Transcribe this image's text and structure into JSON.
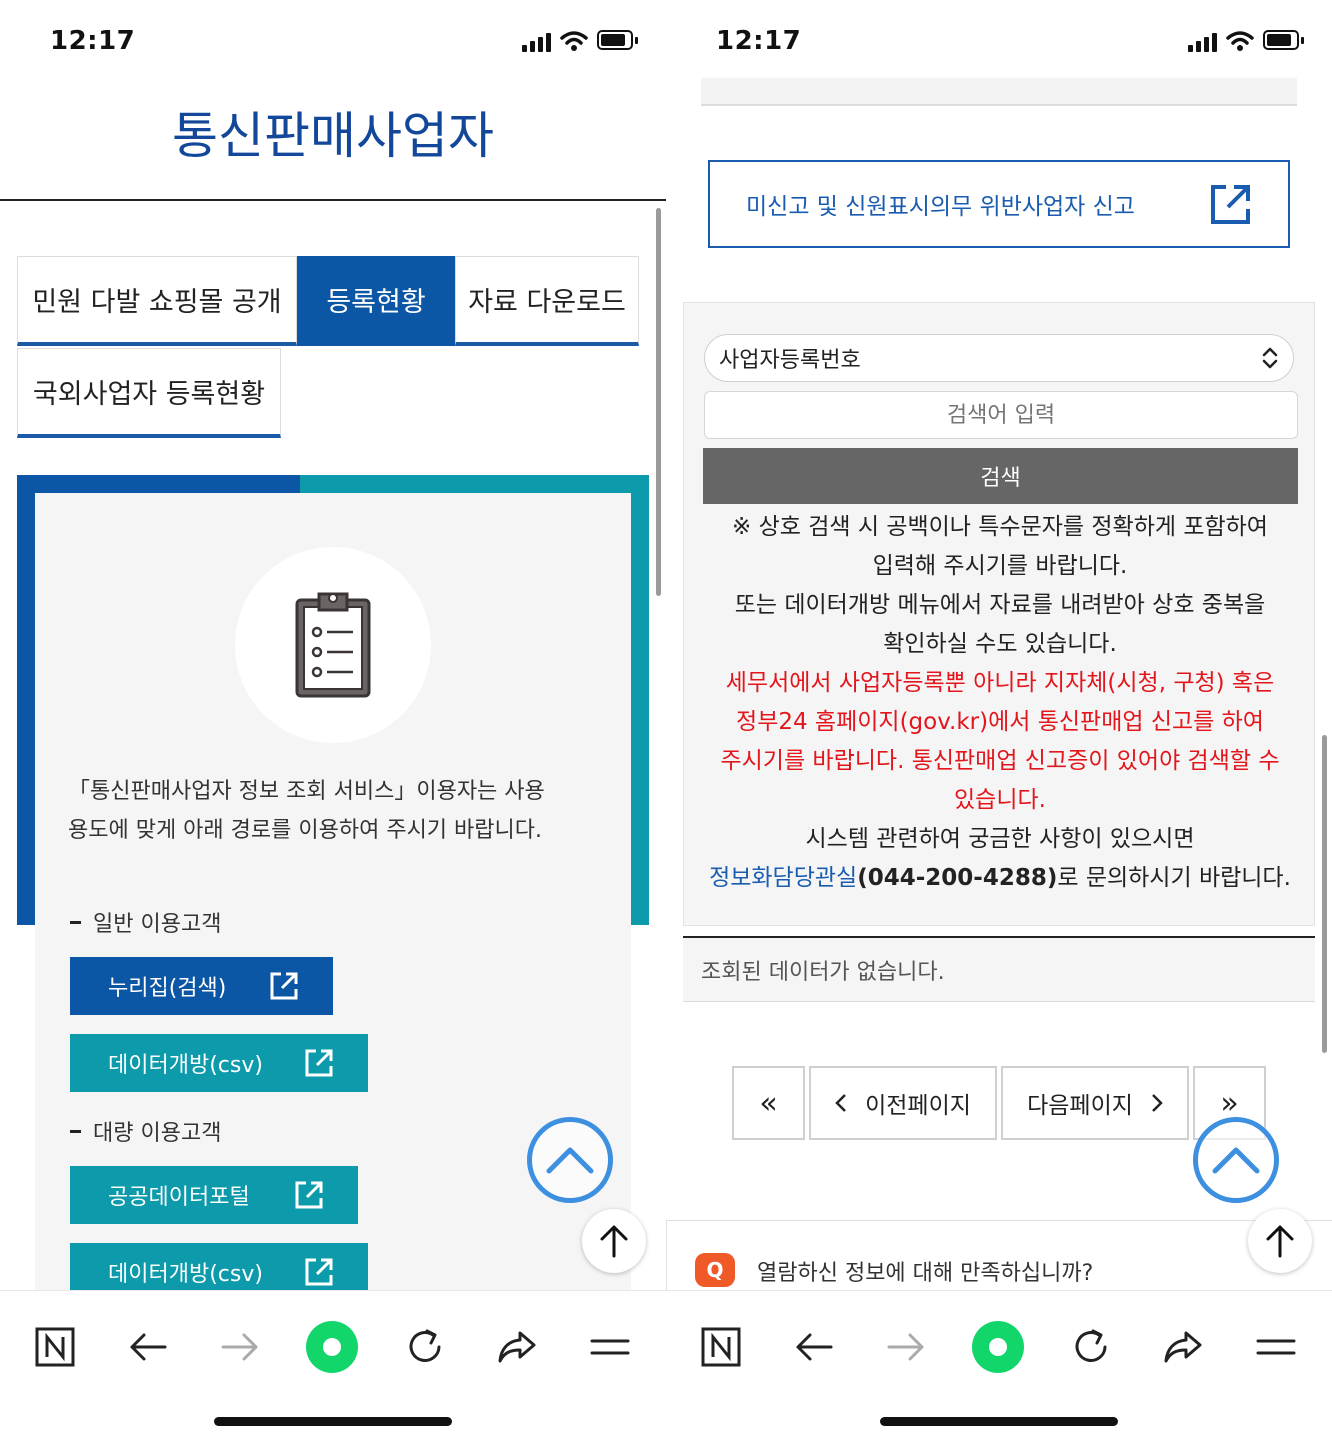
{
  "status_bar": {
    "time": "12:17"
  },
  "left": {
    "page_title": "통신판매사업자",
    "tabs": [
      {
        "label": "민원 다발 쇼핑몰 공개",
        "active": false
      },
      {
        "label": "등록현황",
        "active": true
      },
      {
        "label": "자료 다운로드",
        "active": false
      },
      {
        "label": "국외사업자 등록현황",
        "active": false
      }
    ],
    "card": {
      "icon": "clipboard-list-icon",
      "intro_line1": "「통신판매사업자 정보 조회 서비스」이용자는 사용",
      "intro_line2": "용도에 맞게 아래 경로를 이용하여 주시기 바랍니다.",
      "section_general": "일반 이용고객",
      "section_bulk": "대량 이용고객",
      "btn_nurijip": "누리집(검색)",
      "btn_open_data_1": "데이터개방(csv)",
      "btn_portal": "공공데이터포털",
      "btn_open_data_2": "데이터개방(csv)"
    }
  },
  "right": {
    "report_button": "미신고 및 신원표시의무 위반사업자 신고",
    "search": {
      "select_value": "사업자등록번호",
      "input_placeholder": "검색어 입력",
      "button": "검색"
    },
    "notice": {
      "line1": "※ 상호 검색 시 공백이나 특수문자를 정확하게 포함하여",
      "line2": "입력해 주시기를 바랍니다.",
      "line3": "또는 데이터개방 메뉴에서 자료를 내려받아 상호 중복을",
      "line4": "확인하실 수도 있습니다.",
      "red1": "세무서에서 사업자등록뿐 아니라 지자체(시청, 구청) 혹은",
      "red2": "정부24 홈페이지(gov.kr)에서 통신판매업 신고를 하여",
      "red3": "주시기를 바랍니다. 통신판매업 신고증이 있어야 검색할 수",
      "red4": "있습니다.",
      "line5": "시스템 관련하여 궁금한 사항이 있으시면",
      "contact_link": "정보화담당관실",
      "contact_phone": "(044-200-4288)",
      "contact_tail": "로 문의하시기 바랍니다."
    },
    "no_data": "조회된 데이터가 없습니다.",
    "pagination": {
      "first": "«",
      "prev": "이전페이지",
      "next": "다음페이지",
      "last": "»"
    },
    "survey": {
      "badge": "Q",
      "question": "열람하신 정보에 대해 만족하십니까?"
    }
  },
  "colors": {
    "primary_blue": "#0c56a6",
    "title_blue": "#12479a",
    "teal": "#0d9bab",
    "notice_red": "#e2161c",
    "search_gray": "#666666"
  }
}
